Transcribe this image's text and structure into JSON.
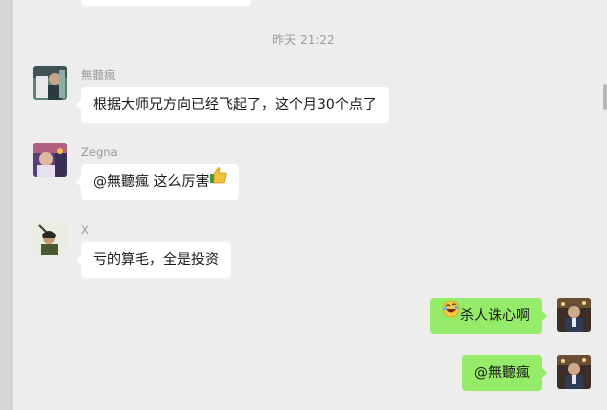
{
  "timestamp": "昨天 21:22",
  "messages": [
    {
      "sender": "無聽瘋",
      "text": "根据大师兄方向已经飞起了，这个月30个点了"
    },
    {
      "sender": "Zegna",
      "text": "@無聽瘋 这么厉害"
    },
    {
      "sender": "X",
      "text": "亏的算毛，全是投资"
    },
    {
      "sender": "",
      "text": "杀人诛心啊"
    },
    {
      "sender": "",
      "text": "@無聽瘋"
    }
  ],
  "icons": {
    "thumbs_up": "thumbs-up-emoji",
    "laugh_cry": "rolling-laughing-emoji"
  },
  "colors": {
    "background": "#ededed",
    "bubble_in": "#ffffff",
    "bubble_out": "#95ec69"
  }
}
